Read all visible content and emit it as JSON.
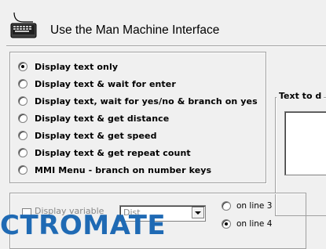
{
  "header": {
    "title": "Use the Man Machine Interface",
    "icon": "keyboard-icon"
  },
  "options": [
    {
      "label": "Display text only",
      "checked": true
    },
    {
      "label": "Display text & wait for enter",
      "checked": false
    },
    {
      "label": "Display text, wait for yes/no & branch on yes",
      "checked": false
    },
    {
      "label": "Display text & get distance",
      "checked": false
    },
    {
      "label": "Display text & get speed",
      "checked": false
    },
    {
      "label": "Display text & get repeat count",
      "checked": false
    },
    {
      "label": "MMI Menu - branch on number keys",
      "checked": false
    }
  ],
  "text_group": {
    "legend": "Text to d"
  },
  "lower": {
    "variable_label": "Display variable",
    "variable_value": "Dist",
    "line_options": [
      {
        "label": "on line 3",
        "checked": false
      },
      {
        "label": "on line 4",
        "checked": true
      }
    ]
  },
  "watermark": "CTROMATE",
  "colors": {
    "watermark": "#1f6ab4",
    "background": "#f0f0f0"
  }
}
